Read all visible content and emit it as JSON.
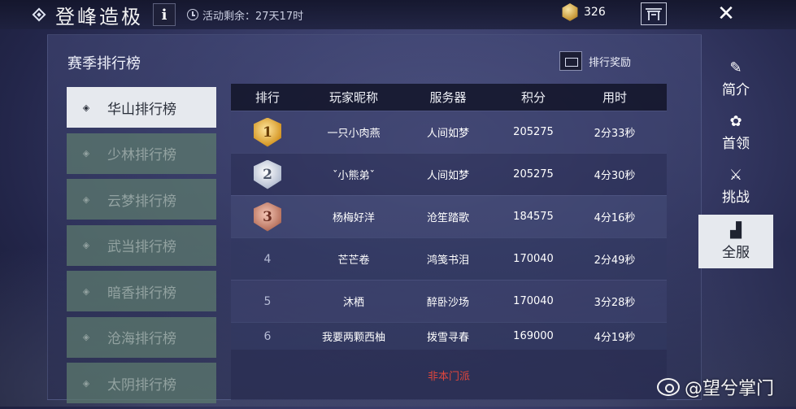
{
  "header": {
    "title": "登峰造极",
    "info_label": "i",
    "timer_text": "活动剩余：27天17时",
    "currency_amount": "326",
    "close_label": "✕"
  },
  "panel": {
    "title": "赛季排行榜",
    "reward_label": "排行奖励"
  },
  "boards": [
    {
      "label": "华山排行榜",
      "active": true
    },
    {
      "label": "少林排行榜"
    },
    {
      "label": "云梦排行榜"
    },
    {
      "label": "武当排行榜"
    },
    {
      "label": "暗香排行榜"
    },
    {
      "label": "沧海排行榜"
    },
    {
      "label": "太阴排行榜"
    }
  ],
  "table": {
    "headers": [
      "排行",
      "玩家昵称",
      "服务器",
      "积分",
      "用时"
    ],
    "rows": [
      {
        "rank": "1",
        "name": "一只小肉燕",
        "server": "人间如梦",
        "score": "205275",
        "time": "2分33秒"
      },
      {
        "rank": "2",
        "name": "ˇ小熊弟ˇ",
        "server": "人间如梦",
        "score": "205275",
        "time": "4分30秒"
      },
      {
        "rank": "3",
        "name": "杨梅好洋",
        "server": "沧笙踏歌",
        "score": "184575",
        "time": "4分16秒"
      },
      {
        "rank": "4",
        "name": "芒芒卷",
        "server": "鸿笺书泪",
        "score": "170040",
        "time": "2分49秒"
      },
      {
        "rank": "5",
        "name": "沐栖",
        "server": "醉卧沙场",
        "score": "170040",
        "time": "3分28秒"
      },
      {
        "rank": "6",
        "name": "我要两颗西柚",
        "server": "拨雪寻春",
        "score": "169000",
        "time": "4分19秒"
      }
    ],
    "footer_text": "非本门派"
  },
  "side_tabs": [
    {
      "label": "简介",
      "icon": "scroll-icon"
    },
    {
      "label": "首领",
      "icon": "boss-icon"
    },
    {
      "label": "挑战",
      "icon": "crossed-swords-icon"
    },
    {
      "label": "全服",
      "icon": "bar-chart-icon",
      "active": true
    }
  ],
  "watermark": "@望兮掌门"
}
